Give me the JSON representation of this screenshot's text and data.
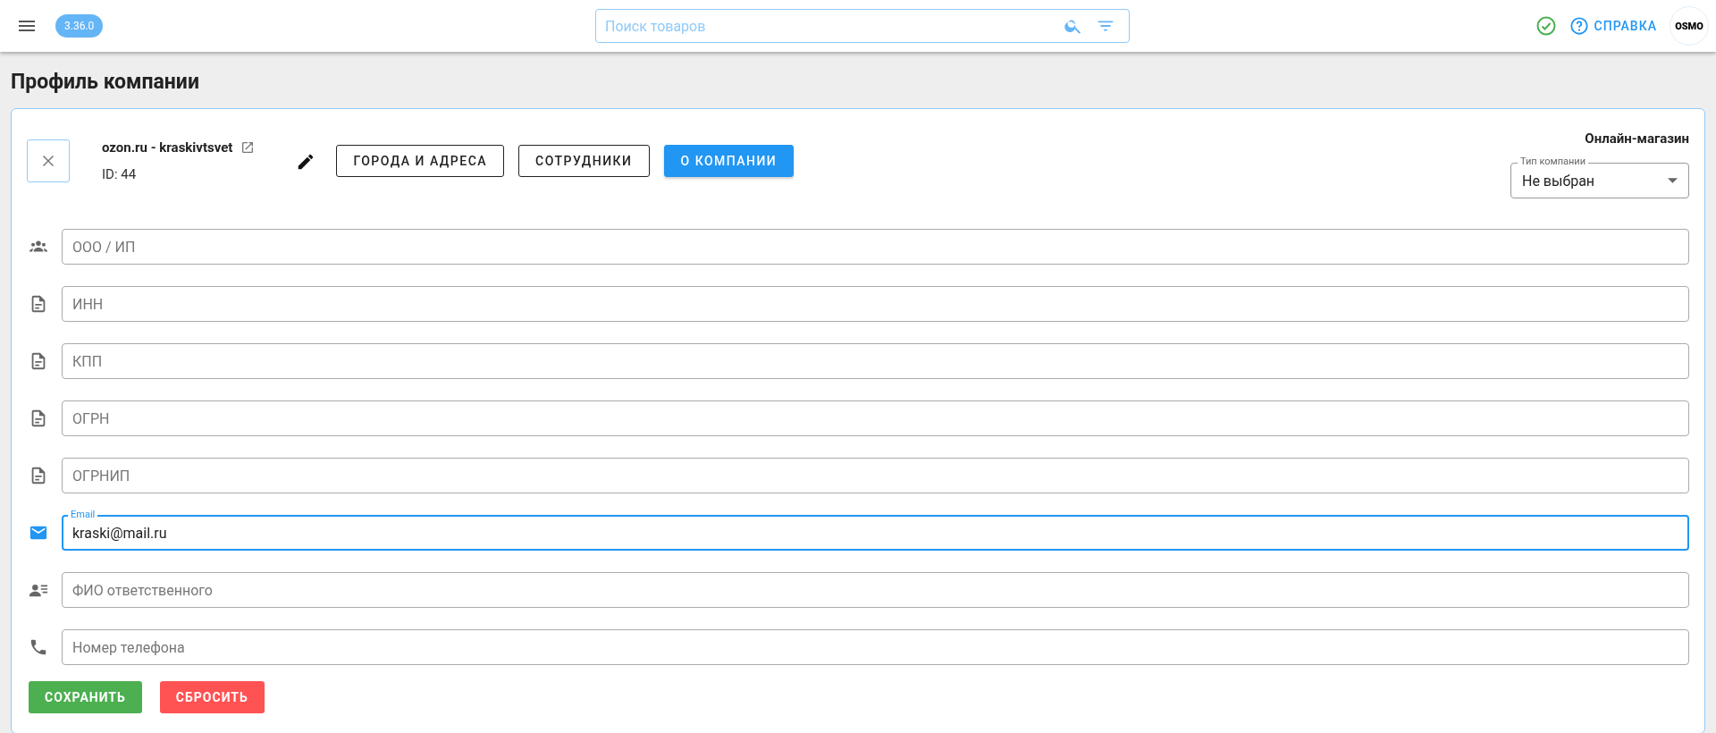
{
  "topbar": {
    "version": "3.36.0",
    "search": {
      "placeholder": "Поиск товаров"
    },
    "help": "СПРАВКА",
    "logo": "OSMO"
  },
  "page_title": "Профиль компании",
  "company": {
    "name": "ozon.ru - kraskivtsvet",
    "id": "ID: 44",
    "type_label": "Онлайн-магазин",
    "type_select": {
      "label": "Тип компании",
      "value": "Не выбран"
    }
  },
  "tabs": [
    {
      "label": "ГОРОДА И АДРЕСА",
      "selected": false
    },
    {
      "label": "СОТРУДНИКИ",
      "selected": false
    },
    {
      "label": "О КОМПАНИИ",
      "selected": true
    }
  ],
  "fields": [
    {
      "kind": "group",
      "placeholder": "ООО / ИП",
      "focused": false
    },
    {
      "kind": "document",
      "placeholder": "ИНН",
      "focused": false
    },
    {
      "kind": "document",
      "placeholder": "КПП",
      "focused": false
    },
    {
      "kind": "document",
      "placeholder": "ОГРН",
      "focused": false
    },
    {
      "kind": "document",
      "placeholder": "ОГРНИП",
      "focused": false
    },
    {
      "kind": "mail",
      "label": "Email",
      "value": "kraski@mail.ru",
      "focused": true
    },
    {
      "kind": "contact",
      "placeholder": "ФИО ответственного",
      "focused": false
    },
    {
      "kind": "phone",
      "placeholder": "Номер телефона",
      "focused": false
    }
  ],
  "buttons": {
    "save": "СОХРАНИТЬ",
    "reset": "СБРОСИТЬ"
  }
}
